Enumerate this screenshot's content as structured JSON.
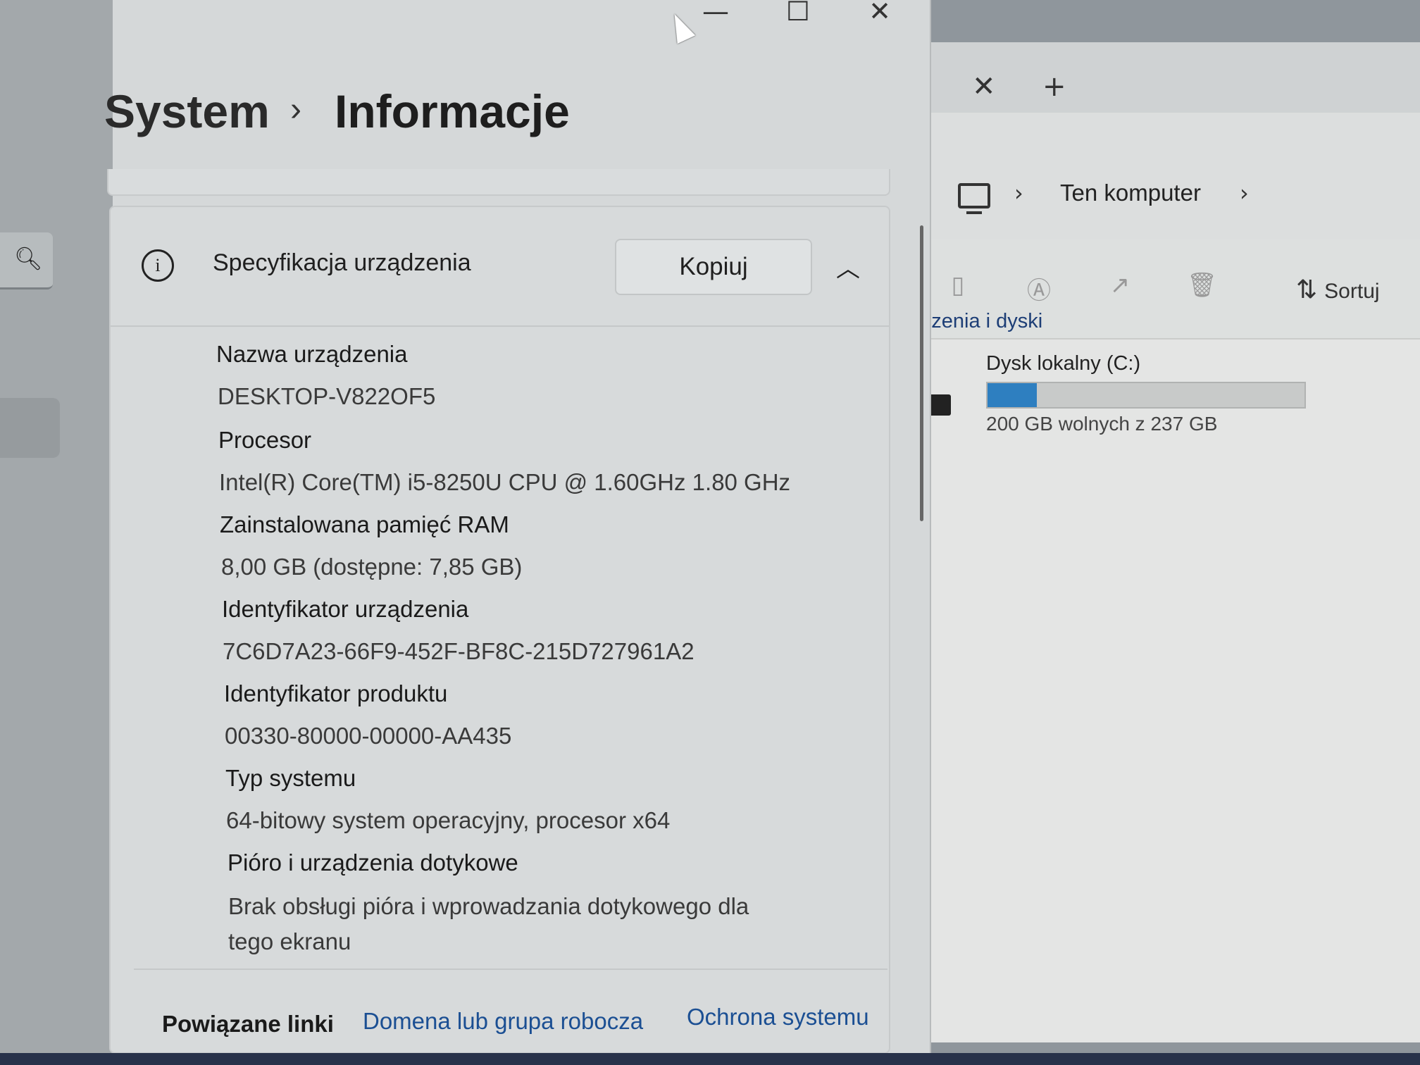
{
  "explorer": {
    "tab_close": "✕",
    "tab_add": "+",
    "address": {
      "location": "Ten komputer"
    },
    "toolbar": {
      "sort_label": "Sortuj"
    },
    "section_label": "ądzenia i dyski",
    "drive": {
      "name": "Dysk lokalny (C:)",
      "free_text": "200 GB wolnych z 237 GB",
      "used_fraction": 0.156,
      "fill_color": "#2e7fc0"
    }
  },
  "settings": {
    "breadcrumb": {
      "parent": "System",
      "separator": "›",
      "current": "Informacje"
    },
    "card": {
      "title": "Specyfikacja urządzenia",
      "copy_label": "Kopiuj",
      "specs": [
        {
          "label": "Nazwa urządzenia",
          "value": "DESKTOP-V822OF5"
        },
        {
          "label": "Procesor",
          "value": "Intel(R) Core(TM) i5-8250U CPU @ 1.60GHz   1.80 GHz"
        },
        {
          "label": "Zainstalowana pamięć RAM",
          "value": "8,00 GB (dostępne: 7,85 GB)"
        },
        {
          "label": "Identyfikator urządzenia",
          "value": "7C6D7A23-66F9-452F-BF8C-215D727961A2"
        },
        {
          "label": "Identyfikator produktu",
          "value": "00330-80000-00000-AA435"
        },
        {
          "label": "Typ systemu",
          "value": "64-bitowy system operacyjny, procesor x64"
        },
        {
          "label": "Pióro i urządzenia dotykowe",
          "value": "Brak obsługi pióra i wprowadzania dotykowego dla tego ekranu"
        }
      ]
    },
    "related": {
      "label": "Powiązane linki",
      "links": [
        "Domena lub grupa robocza",
        "Ochrona systemu"
      ]
    },
    "window": {
      "minimize": "—",
      "maximize": "☐",
      "close": "✕"
    }
  },
  "colors": {
    "link": "#1b4f93",
    "accent": "#2e7fc0"
  }
}
